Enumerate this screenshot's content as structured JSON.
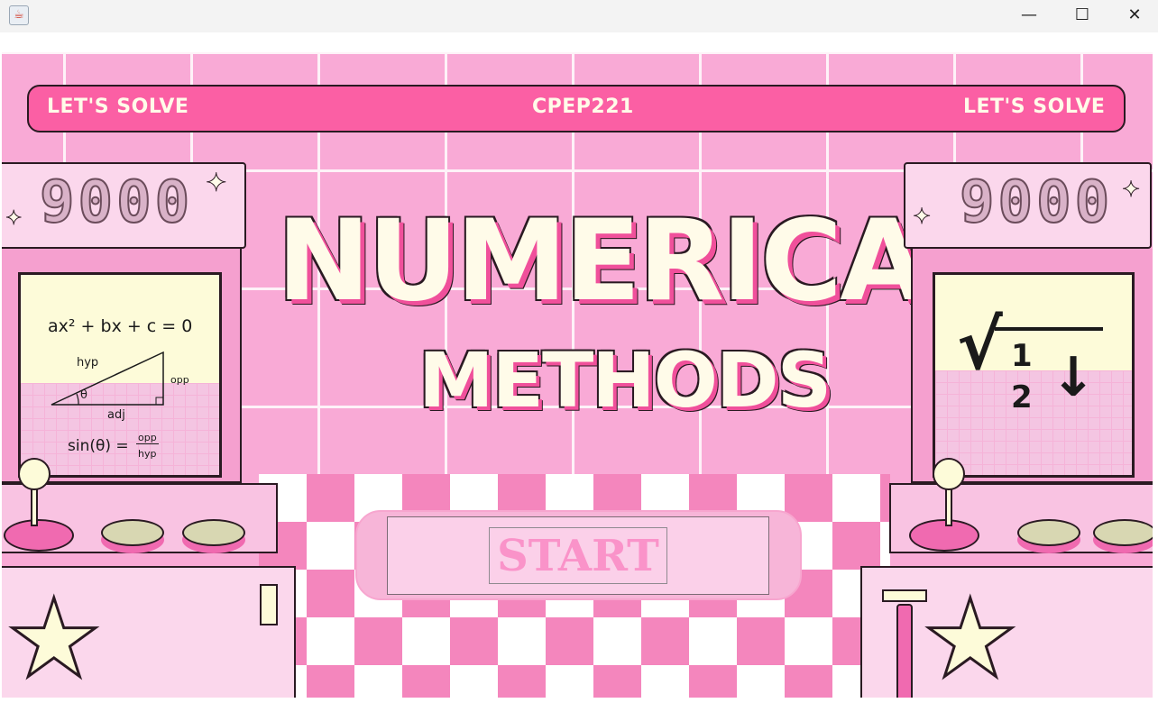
{
  "window": {
    "app_icon": "java-cup-icon",
    "controls": {
      "minimize": "—",
      "maximize": "☐",
      "close": "✕"
    }
  },
  "banner": {
    "left_text": "LET'S SOLVE",
    "center_text": "CPEP221",
    "right_text": "LET'S SOLVE"
  },
  "title": {
    "line1": "NUMERICAL",
    "line2": "METHODS"
  },
  "left_cabinet": {
    "score": "9000",
    "equation_quadratic": "ax² + bx + c = 0",
    "label_hyp": "hyp",
    "label_opp": "opp",
    "label_adj": "adj",
    "label_theta": "θ",
    "equation_sine": "sin(θ) =",
    "fraction_num": "opp",
    "fraction_den": "hyp"
  },
  "right_cabinet": {
    "score": "9000",
    "radical": "√",
    "numerator": "1",
    "denominator": "2",
    "arrow": "↓"
  },
  "start": {
    "label": "START"
  },
  "colors": {
    "background": "#f9aad6",
    "banner": "#fb5fa4",
    "title_fill": "#fffbe9",
    "title_shadow": "#f0509b",
    "start_text": "#fa93c9"
  }
}
